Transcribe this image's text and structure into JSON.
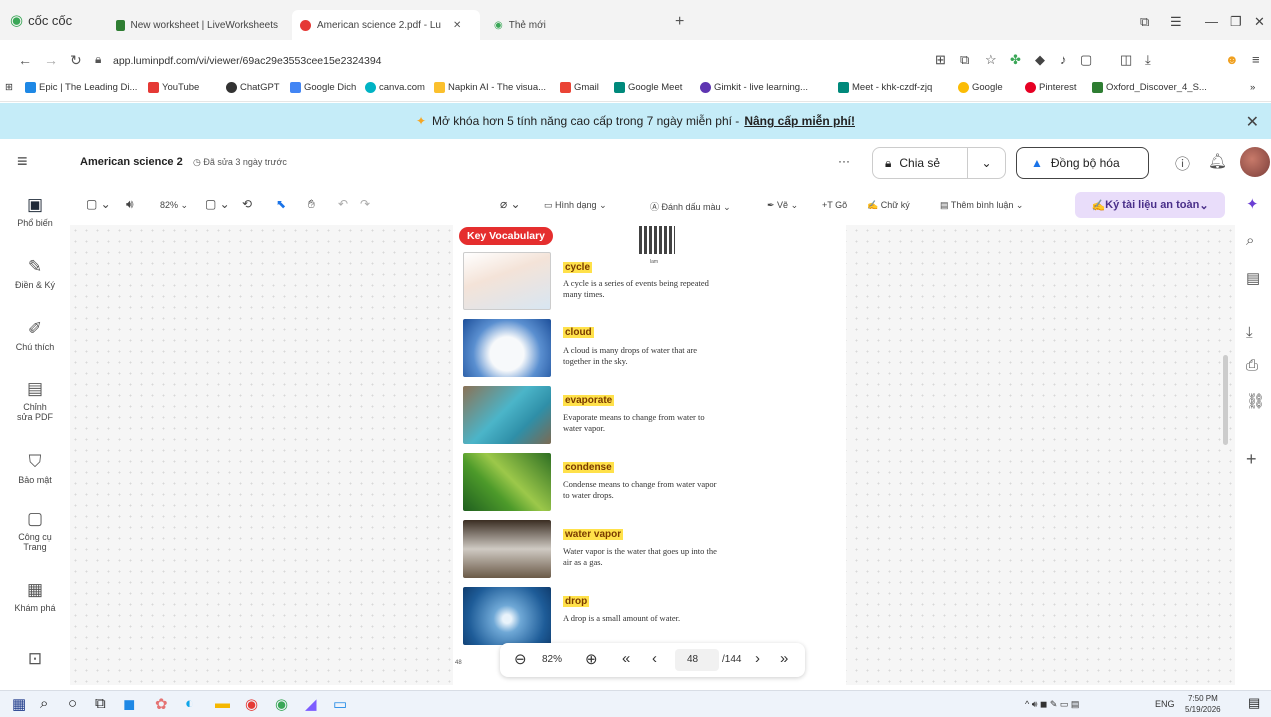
{
  "browser": {
    "brand": "cốc cốc",
    "tabs": [
      {
        "title": "New worksheet | LiveWorksheets",
        "active": false
      },
      {
        "title": "American science 2.pdf - Lu",
        "active": true
      },
      {
        "title": "Thẻ mới",
        "active": false
      }
    ],
    "url": "app.luminpdf.com/vi/viewer/69ac29e3553cee15e2324394",
    "bookmarks": [
      "Epic | The Leading Di...",
      "YouTube",
      "ChatGPT",
      "Google Dich",
      "canva.com",
      "Napkin AI - The visua...",
      "Gmail",
      "Google Meet",
      "Gimkit - live learning...",
      "Meet - khk-czdf-zjq",
      "Google",
      "Pinterest",
      "Oxford_Discover_4_S..."
    ]
  },
  "promo": {
    "text": "Mở khóa hơn 5 tính năng cao cấp trong 7 ngày miễn phí -",
    "link": "Nâng cấp miễn phí!"
  },
  "header": {
    "doc_title": "American science 2",
    "edited": "Đã sửa 3 ngày trước",
    "share": "Chia sẻ",
    "sync": "Đồng bộ hóa"
  },
  "toolbar": {
    "zoom": "82%",
    "shape": "Hình dạng",
    "highlight": "Đánh dấu màu",
    "draw": "Vẽ",
    "type": "Gõ",
    "signature": "Chữ ký",
    "comment": "Thêm bình luận",
    "sign_secure": "Ký tài liệu an toàn"
  },
  "sidebar": [
    {
      "label": "Phổ biến",
      "icon": "clipboard-icon"
    },
    {
      "label": "Điền & Ký",
      "icon": "fill-sign-icon"
    },
    {
      "label": "Chú thích",
      "icon": "annotate-icon"
    },
    {
      "label": "Chỉnh sửa PDF",
      "icon": "edit-pdf-icon"
    },
    {
      "label": "Bảo mật",
      "icon": "shield-icon"
    },
    {
      "label": "Công cụ Trang",
      "icon": "page-tools-icon"
    },
    {
      "label": "Khám phá",
      "icon": "explore-icon"
    }
  ],
  "document": {
    "heading": "Key Vocabulary",
    "qr_label": "lam",
    "page_number": "48",
    "entries": [
      {
        "term": "cycle",
        "definition": "A cycle is a series of events being repeated many times."
      },
      {
        "term": "cloud",
        "definition": "A cloud is many drops of water that are together in the sky."
      },
      {
        "term": "evaporate",
        "definition": "Evaporate means to change from water to water vapor."
      },
      {
        "term": "condense",
        "definition": "Condense means to change from water vapor to water drops."
      },
      {
        "term": "water vapor",
        "definition": "Water vapor is the water that goes up into the air as a gas."
      },
      {
        "term": "drop",
        "definition": "A drop is a small amount of water."
      }
    ]
  },
  "zoombar": {
    "zoom": "82%",
    "page": "48",
    "total": "/144"
  },
  "taskbar": {
    "lang": "ENG",
    "time": "7:50 PM",
    "date": "5/19/2026"
  }
}
